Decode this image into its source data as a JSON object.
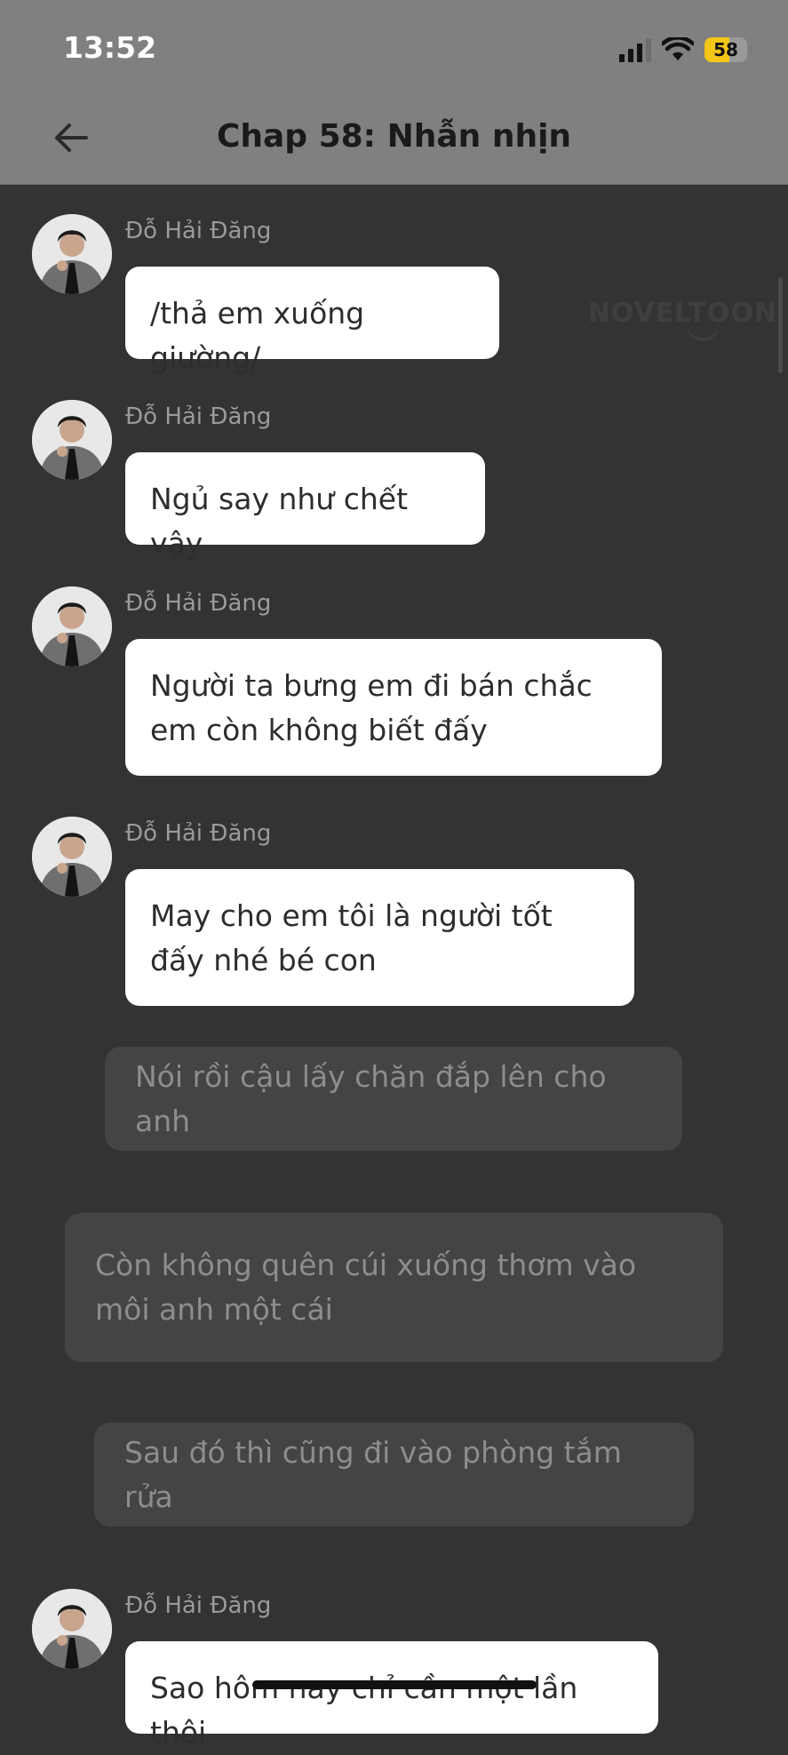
{
  "status_bar": {
    "time": "13:52",
    "battery": "58",
    "battery_level": 0.58
  },
  "header": {
    "title": "Chap 58: Nhẫn nhịn"
  },
  "watermark": "NOVELTOON",
  "messages": [
    {
      "name": "Đỗ Hải Đăng",
      "text": "/thả em xuống giường/"
    },
    {
      "name": "Đỗ Hải Đăng",
      "text": "Ngủ say như chết vậy"
    },
    {
      "name": "Đỗ Hải Đăng",
      "text": "Người ta bưng em đi bán chắc em còn không biết đấy"
    },
    {
      "name": "Đỗ Hải Đăng",
      "text": "May cho em tôi là người tốt đấy nhé bé con"
    }
  ],
  "narrations": [
    {
      "text": "Nói rồi cậu lấy chăn đắp lên cho anh"
    },
    {
      "text": "Còn không quên cúi xuống thơm vào môi anh một cái"
    },
    {
      "text": "Sau đó thì cũng đi vào phòng tắm rửa"
    }
  ],
  "last_message": {
    "name": "Đỗ Hải Đăng",
    "text": "Sao hôm nay chỉ cần một lần thôi"
  }
}
